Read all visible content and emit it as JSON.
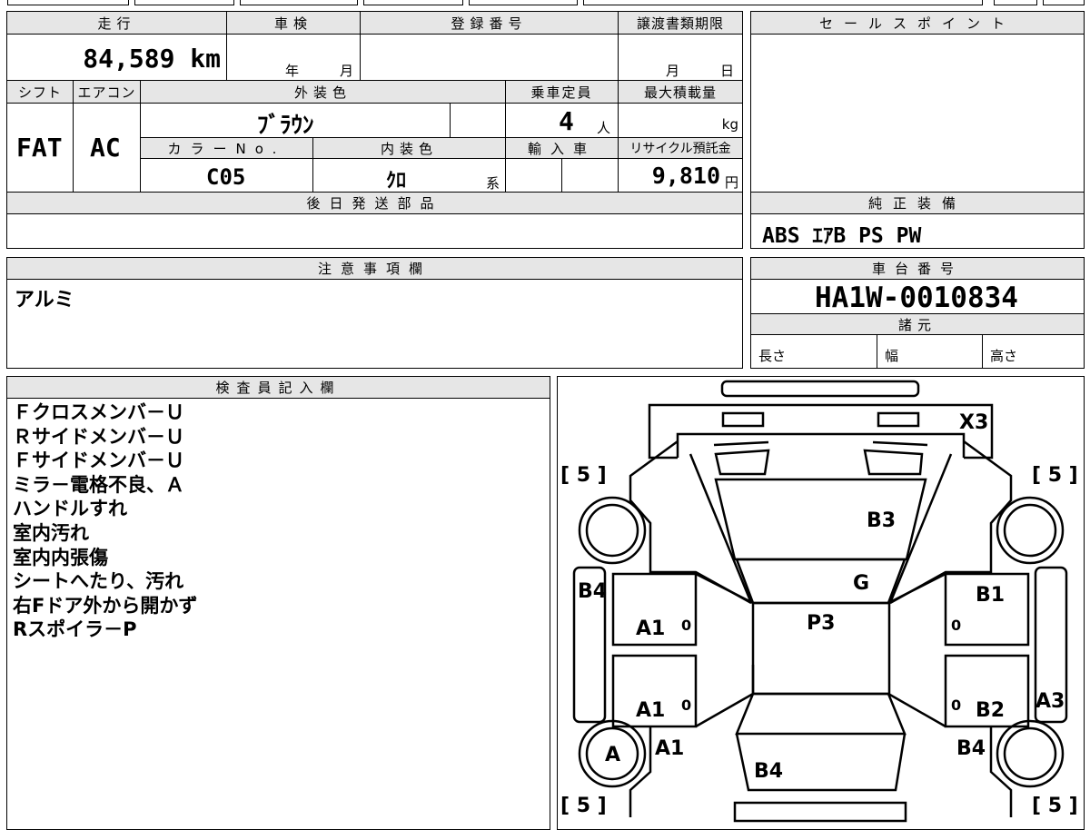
{
  "basic": {
    "mileage_label": "走行",
    "shaken_label": "車検",
    "reg_label": "登録番号",
    "deadline_label": "譲渡書類期限",
    "mileage": "84,589 km",
    "shaken_year": "年",
    "shaken_month": "月",
    "deadline_month": "月",
    "deadline_day": "日",
    "shift_label": "シフト",
    "ac_label": "エアコン",
    "color_label": "外装色",
    "capacity_label": "乗車定員",
    "maxload_label": "最大積載量",
    "shift": "FAT",
    "ac": "AC",
    "color": "ﾌﾞﾗｳﾝ",
    "capacity": "4",
    "capacity_unit": "人",
    "load_unit": "kg",
    "colorno_label": "カラーNo.",
    "interior_label": "内装色",
    "import_label": "輸入車",
    "recycle_label": "リサイクル預託金",
    "colorno": "C05",
    "interior": "ｸﾛ",
    "interior_suffix": "系",
    "recycle": "9,810",
    "recycle_unit": "円"
  },
  "later_parts": {
    "label": "後日発送部品"
  },
  "sales_point": {
    "label": "セールスポイント"
  },
  "equipment": {
    "label": "純正装備",
    "value": "ABS ｴｱB PS PW"
  },
  "notes": {
    "label": "注意事項欄",
    "value": "アルミ"
  },
  "chassis": {
    "label": "車台番号",
    "value": "HA1W-0010834"
  },
  "specs": {
    "label": "諸元",
    "length": "長さ",
    "width": "幅",
    "height": "高さ"
  },
  "inspector": {
    "label": "検査員記入欄",
    "lines": [
      "Ｆクロスメンバ－Ｕ",
      "Ｒサイドメンバ－Ｕ",
      "Ｆサイドメンバ－Ｕ",
      "ミラ－電格不良、Ａ",
      "ハンドルすれ",
      "室内汚れ",
      "室内内張傷",
      "シートへたり、汚れ",
      "右Fドア外から開かず",
      "Rスポイラ－P"
    ]
  },
  "diagram": {
    "tire_bracket": "[ 5 ]",
    "tire_value": "5",
    "marks": {
      "x3": "X3",
      "b3": "B3",
      "g": "G",
      "b4_left": "B4",
      "b1": "B1",
      "a1_upper": "A1",
      "p3": "P3",
      "a1_lower": "A1",
      "b2": "B2",
      "a3": "A3",
      "a_wheel": "A",
      "a1_door": "A1",
      "b4_right": "B4",
      "b4_rear": "B4",
      "zero": "0"
    }
  }
}
